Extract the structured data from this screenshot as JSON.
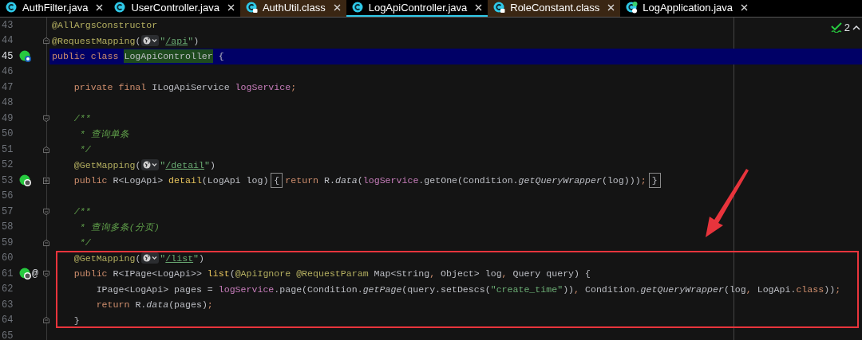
{
  "tabs": [
    {
      "label": "AuthFilter.java",
      "kind": "class",
      "selected": false
    },
    {
      "label": "UserController.java",
      "kind": "class",
      "selected": false
    },
    {
      "label": "AuthUtil.class",
      "kind": "readonly",
      "selected": false
    },
    {
      "label": "LogApiController.java",
      "kind": "class",
      "selected": true
    },
    {
      "label": "RoleConstant.class",
      "kind": "readonly",
      "selected": false
    },
    {
      "label": "LogApplication.java",
      "kind": "app",
      "selected": false
    }
  ],
  "inspection": {
    "count": "2"
  },
  "lines": [
    {
      "number": "43",
      "current": false,
      "boxed": false,
      "tokens": [
        {
          "kind": "ann",
          "text": "@AllArgsConstructor"
        }
      ]
    },
    {
      "number": "44",
      "current": false,
      "boxed": false,
      "fold": {
        "kind": "end"
      },
      "tokens": [
        {
          "kind": "ann",
          "text": "@RequestMapping"
        },
        {
          "kind": "plain",
          "text": "("
        },
        {
          "kind": "inlay"
        },
        {
          "kind": "str",
          "text": "\""
        },
        {
          "kind": "link",
          "text": "/api"
        },
        {
          "kind": "str",
          "text": "\""
        },
        {
          "kind": "plain",
          "text": ")"
        }
      ]
    },
    {
      "number": "45",
      "current": true,
      "boxed": false,
      "gutter": {
        "kind": "class"
      },
      "tokens": [
        {
          "kind": "kw",
          "text": "public class "
        },
        {
          "kind": "classname",
          "text": "LogApiController"
        },
        {
          "kind": "plain",
          "text": " {"
        }
      ]
    },
    {
      "number": "46",
      "current": false,
      "boxed": false
    },
    {
      "number": "47",
      "current": false,
      "boxed": false,
      "tokens": [
        {
          "kind": "kw",
          "text": "    private final "
        },
        {
          "kind": "plain",
          "text": "ILogApiService "
        },
        {
          "kind": "field",
          "text": "logService"
        },
        {
          "kind": "punct",
          "text": ";"
        }
      ]
    },
    {
      "number": "48",
      "current": false,
      "boxed": false
    },
    {
      "number": "49",
      "current": false,
      "boxed": false,
      "fold": {
        "kind": "start"
      },
      "tokens": [
        {
          "kind": "doc",
          "text": "    /**"
        }
      ]
    },
    {
      "number": "50",
      "current": false,
      "boxed": false,
      "tokens": [
        {
          "kind": "doc",
          "text": "     * 查询单条"
        }
      ]
    },
    {
      "number": "51",
      "current": false,
      "boxed": false,
      "fold": {
        "kind": "end"
      },
      "tokens": [
        {
          "kind": "doc",
          "text": "     */"
        }
      ]
    },
    {
      "number": "52",
      "current": false,
      "boxed": false,
      "tokens": [
        {
          "kind": "ann",
          "text": "    @GetMapping"
        },
        {
          "kind": "plain",
          "text": "("
        },
        {
          "kind": "inlay"
        },
        {
          "kind": "str",
          "text": "\""
        },
        {
          "kind": "link",
          "text": "/detail"
        },
        {
          "kind": "str",
          "text": "\""
        },
        {
          "kind": "plain",
          "text": ")"
        }
      ]
    },
    {
      "number": "53",
      "current": false,
      "boxed": false,
      "fold": {
        "kind": "collapsed"
      },
      "gutter": {
        "kind": "web"
      },
      "tokens": [
        {
          "kind": "kw",
          "text": "    public "
        },
        {
          "kind": "plain",
          "text": "R<LogApi> "
        },
        {
          "kind": "fn",
          "text": "detail"
        },
        {
          "kind": "plain",
          "text": "(LogApi log)"
        },
        {
          "kind": "brace",
          "text": "{"
        },
        {
          "kind": "kw",
          "text": "return "
        },
        {
          "kind": "plain",
          "text": "R."
        },
        {
          "kind": "static",
          "text": "data"
        },
        {
          "kind": "plain",
          "text": "("
        },
        {
          "kind": "field",
          "text": "logService"
        },
        {
          "kind": "plain",
          "text": ".getOne(Condition."
        },
        {
          "kind": "static",
          "text": "getQueryWrapper"
        },
        {
          "kind": "plain",
          "text": "(log)))"
        },
        {
          "kind": "punct",
          "text": ";"
        },
        {
          "kind": "brace",
          "text": "}"
        }
      ]
    },
    {
      "number": "56",
      "current": false,
      "boxed": false
    },
    {
      "number": "57",
      "current": false,
      "boxed": false,
      "fold": {
        "kind": "start"
      },
      "tokens": [
        {
          "kind": "doc",
          "text": "    /**"
        }
      ]
    },
    {
      "number": "58",
      "current": false,
      "boxed": false,
      "tokens": [
        {
          "kind": "doc",
          "text": "     * 查询多条(分页)"
        }
      ]
    },
    {
      "number": "59",
      "current": false,
      "boxed": false,
      "fold": {
        "kind": "end"
      },
      "tokens": [
        {
          "kind": "doc",
          "text": "     */"
        }
      ]
    },
    {
      "number": "60",
      "current": false,
      "boxed": true,
      "tokens": [
        {
          "kind": "ann",
          "text": "    @GetMapping"
        },
        {
          "kind": "plain",
          "text": "("
        },
        {
          "kind": "inlay"
        },
        {
          "kind": "str",
          "text": "\""
        },
        {
          "kind": "link",
          "text": "/list"
        },
        {
          "kind": "str",
          "text": "\""
        },
        {
          "kind": "plain",
          "text": ")"
        }
      ]
    },
    {
      "number": "61",
      "current": false,
      "boxed": true,
      "fold": {
        "kind": "start"
      },
      "gutter": {
        "kind": "web",
        "text": "@"
      },
      "tokens": [
        {
          "kind": "kw",
          "text": "    public "
        },
        {
          "kind": "plain",
          "text": "R<IPage<LogApi>> "
        },
        {
          "kind": "fn",
          "text": "list"
        },
        {
          "kind": "plain",
          "text": "("
        },
        {
          "kind": "ann",
          "text": "@ApiIgnore @RequestParam"
        },
        {
          "kind": "plain",
          "text": " Map<String"
        },
        {
          "kind": "punct",
          "text": ","
        },
        {
          "kind": "plain",
          "text": " Object> log"
        },
        {
          "kind": "punct",
          "text": ","
        },
        {
          "kind": "plain",
          "text": " Query query) {"
        }
      ]
    },
    {
      "number": "62",
      "current": false,
      "boxed": true,
      "tokens": [
        {
          "kind": "plain",
          "text": "        IPage<LogApi> pages = "
        },
        {
          "kind": "field",
          "text": "logService"
        },
        {
          "kind": "plain",
          "text": ".page(Condition."
        },
        {
          "kind": "static",
          "text": "getPage"
        },
        {
          "kind": "plain",
          "text": "(query.setDescs("
        },
        {
          "kind": "str",
          "text": "\"create_time\""
        },
        {
          "kind": "plain",
          "text": "))"
        },
        {
          "kind": "punct",
          "text": ","
        },
        {
          "kind": "plain",
          "text": " Condition."
        },
        {
          "kind": "static",
          "text": "getQueryWrapper"
        },
        {
          "kind": "plain",
          "text": "(log"
        },
        {
          "kind": "punct",
          "text": ","
        },
        {
          "kind": "plain",
          "text": " LogApi."
        },
        {
          "kind": "kw",
          "text": "class"
        },
        {
          "kind": "plain",
          "text": "))"
        },
        {
          "kind": "punct",
          "text": ";"
        }
      ]
    },
    {
      "number": "63",
      "current": false,
      "boxed": true,
      "tokens": [
        {
          "kind": "kw",
          "text": "        return "
        },
        {
          "kind": "plain",
          "text": "R."
        },
        {
          "kind": "static",
          "text": "data"
        },
        {
          "kind": "plain",
          "text": "(pages)"
        },
        {
          "kind": "punct",
          "text": ";"
        }
      ]
    },
    {
      "number": "64",
      "current": false,
      "boxed": true,
      "fold": {
        "kind": "end"
      },
      "tokens": [
        {
          "kind": "plain",
          "text": "    }"
        }
      ]
    },
    {
      "number": "65",
      "current": false,
      "boxed": false
    }
  ]
}
